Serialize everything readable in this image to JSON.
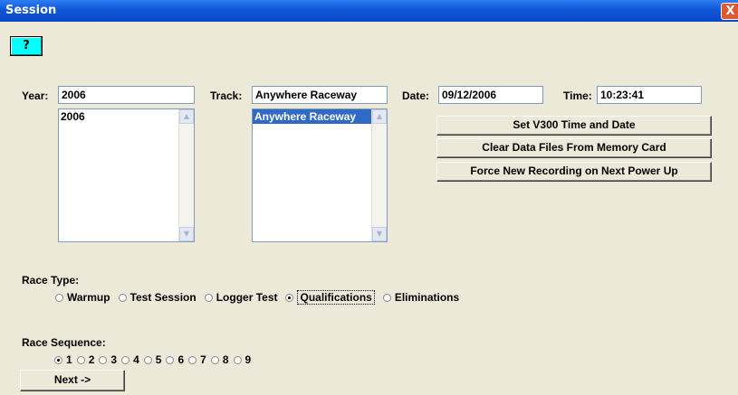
{
  "window": {
    "title": "Session",
    "close_glyph": "X"
  },
  "help": {
    "glyph": "?"
  },
  "year": {
    "label": "Year:",
    "value": "2006",
    "list": [
      "2006"
    ]
  },
  "track": {
    "label": "Track:",
    "value": "Anywhere Raceway",
    "list": [
      "Anywhere Raceway"
    ]
  },
  "date": {
    "label": "Date:",
    "value": "09/12/2006"
  },
  "time": {
    "label": "Time:",
    "value": "10:23:41"
  },
  "actions": [
    "Set V300 Time and Date",
    "Clear Data Files From Memory Card",
    "Force New Recording on Next Power Up"
  ],
  "race_type": {
    "label": "Race Type:",
    "options": [
      "Warmup",
      "Test Session",
      "Logger Test",
      "Qualifications",
      "Eliminations"
    ],
    "selected": "Qualifications"
  },
  "race_sequence": {
    "label": "Race Sequence:",
    "options": [
      "1",
      "2",
      "3",
      "4",
      "5",
      "6",
      "7",
      "8",
      "9"
    ],
    "selected": "1"
  },
  "next_button": "Next ->",
  "colors": {
    "title_bar": "#0a46c4",
    "help_button": "#00ffff",
    "selection": "#316ac5",
    "window_bg": "#ece9d8"
  }
}
